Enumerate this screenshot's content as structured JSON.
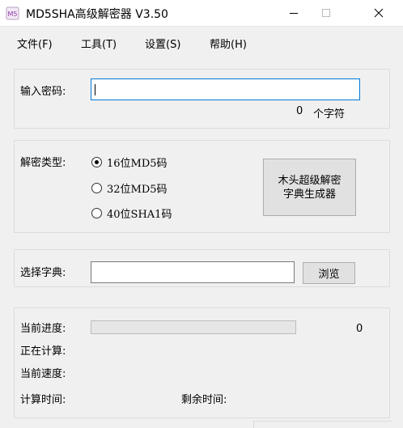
{
  "window": {
    "title": "MD5SHA高级解密器 V3.50",
    "icon": "app-icon"
  },
  "menu": [
    "文件(F)",
    "工具(T)",
    "设置(S)",
    "帮助(H)"
  ],
  "password": {
    "label": "输入密码:",
    "value": "",
    "char_count": "0",
    "char_unit": "个字符"
  },
  "decrypt": {
    "label": "解密类型:",
    "options": [
      "16位MD5码",
      "32位MD5码",
      "40位SHA1码"
    ],
    "selected_index": 0,
    "generator_button": "木头超级解密\n字典生成器"
  },
  "dictionary": {
    "label": "选择字典:",
    "value": "",
    "browse_button": "浏览"
  },
  "status": {
    "progress_label": "当前进度:",
    "progress_fraction": 0,
    "progress_value": "0",
    "computing_label": "正在计算:",
    "speed_label": "当前速度:",
    "elapsed_label": "计算时间:",
    "remaining_label": "剩余时间:"
  },
  "colors": {
    "focus_border": "#0078d7",
    "window_bg": "#f0f0f0"
  }
}
